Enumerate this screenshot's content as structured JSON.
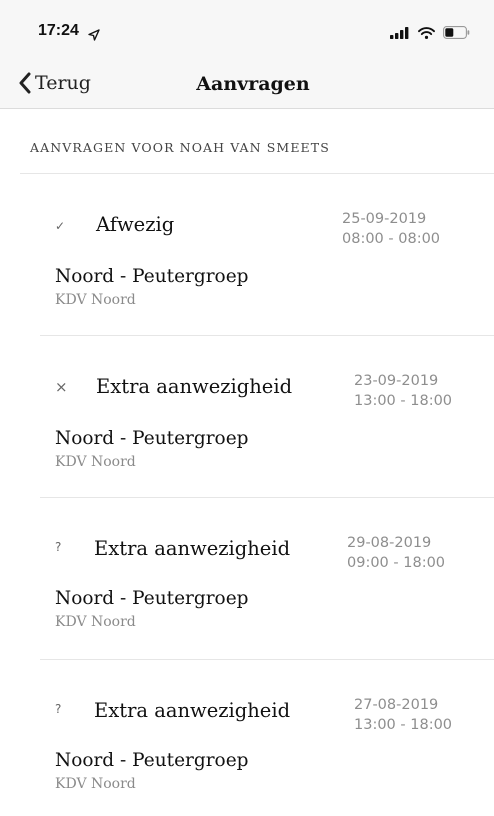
{
  "status_bar": {
    "time": "17:24",
    "location_icon": "location-arrow-icon",
    "signal_icon": "cellular-signal-icon",
    "wifi_icon": "wifi-icon",
    "battery_icon": "battery-icon"
  },
  "nav": {
    "back_label": "Terug",
    "title": "Aanvragen"
  },
  "section_header": "AANVRAGEN VOOR NOAH VAN SMEETS",
  "requests": [
    {
      "status_glyph": "✓",
      "status": "approved",
      "type": "Afwezig",
      "date": "25-09-2019",
      "time": "08:00 - 08:00",
      "group": "Noord - Peutergroep",
      "location": "KDV Noord"
    },
    {
      "status_glyph": "×",
      "status": "rejected",
      "type": "Extra aanwezigheid",
      "date": "23-09-2019",
      "time": "13:00 - 18:00",
      "group": "Noord - Peutergroep",
      "location": "KDV Noord"
    },
    {
      "status_glyph": "?",
      "status": "pending",
      "type": "Extra aanwezigheid",
      "date": "29-08-2019",
      "time": "09:00 - 18:00",
      "group": "Noord - Peutergroep",
      "location": "KDV Noord"
    },
    {
      "status_glyph": "?",
      "status": "pending",
      "type": "Extra aanwezigheid",
      "date": "27-08-2019",
      "time": "13:00 - 18:00",
      "group": "Noord - Peutergroep",
      "location": "KDV Noord"
    }
  ]
}
